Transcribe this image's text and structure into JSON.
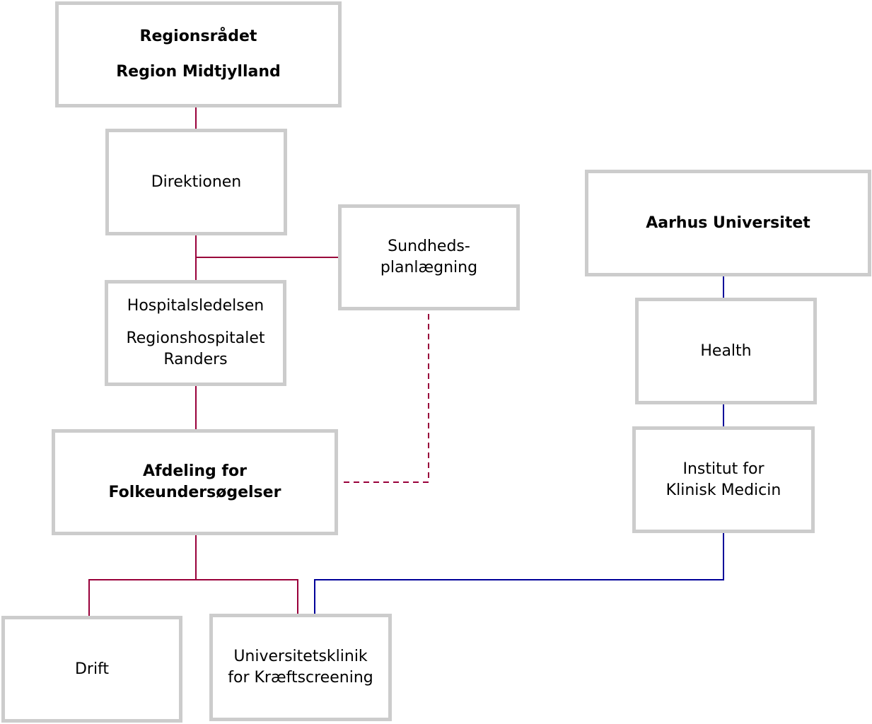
{
  "colors": {
    "region_line": "#99003a",
    "university_line": "#000099",
    "box_border": "#cccccc"
  },
  "nodes": {
    "regionsraadet": {
      "line1": "Regionsrådet",
      "line2": "Region Midtjylland"
    },
    "direktionen": {
      "label": "Direktionen"
    },
    "sundhedsplanlaegning": {
      "line1": "Sundheds-",
      "line2": "planlægning"
    },
    "hospitalsledelsen": {
      "line1": "Hospitalsledelsen",
      "line2": "Regionshospitalet",
      "line3": "Randers"
    },
    "afdeling": {
      "line1": "Afdeling for",
      "line2": "Folkeundersøgelser"
    },
    "drift": {
      "label": "Drift"
    },
    "universitetsklinik": {
      "line1": "Universitetsklinik",
      "line2": "for Kræftscreening"
    },
    "aarhus_universitet": {
      "label": "Aarhus Universitet"
    },
    "health": {
      "label": "Health"
    },
    "institut": {
      "line1": "Institut for",
      "line2": "Klinisk Medicin"
    }
  }
}
